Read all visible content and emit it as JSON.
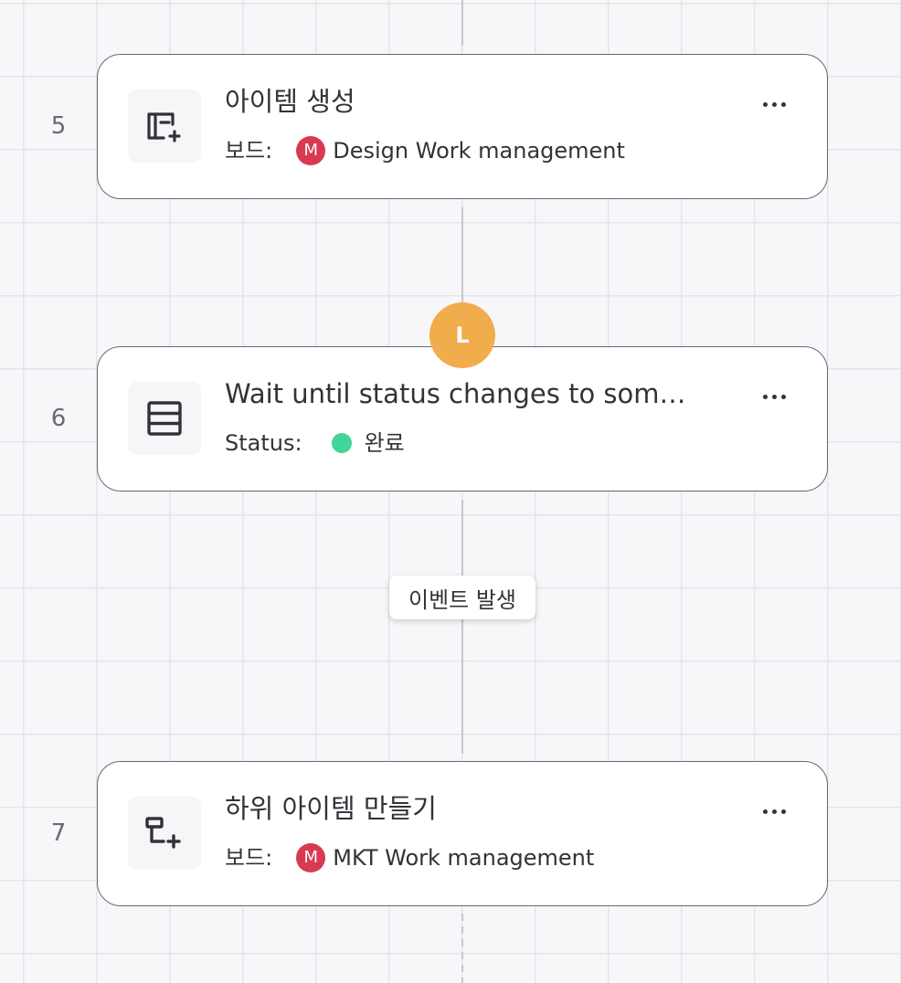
{
  "steps": [
    {
      "number": "5",
      "icon": "create-item-icon",
      "title": "아이템 생성",
      "sub_label": "보드:",
      "badge_letter": "M",
      "sub_value": "Design Work management"
    },
    {
      "number": "6",
      "icon": "wait-table-icon",
      "title": "Wait until status changes to som…",
      "sub_label": "Status:",
      "status_color": "#00c875",
      "sub_value": "완료"
    },
    {
      "number": "7",
      "icon": "create-subitem-icon",
      "title": "하위 아이템 만들기",
      "sub_label": "보드:",
      "badge_letter": "M",
      "sub_value": "MKT Work management"
    }
  ],
  "avatar_initial": "L",
  "event_label": "이벤트 발생",
  "colors": {
    "avatar": "#f1ad4c",
    "board_badge": "#d83a52",
    "status_done": "#00c875",
    "card_border": "#676879"
  }
}
